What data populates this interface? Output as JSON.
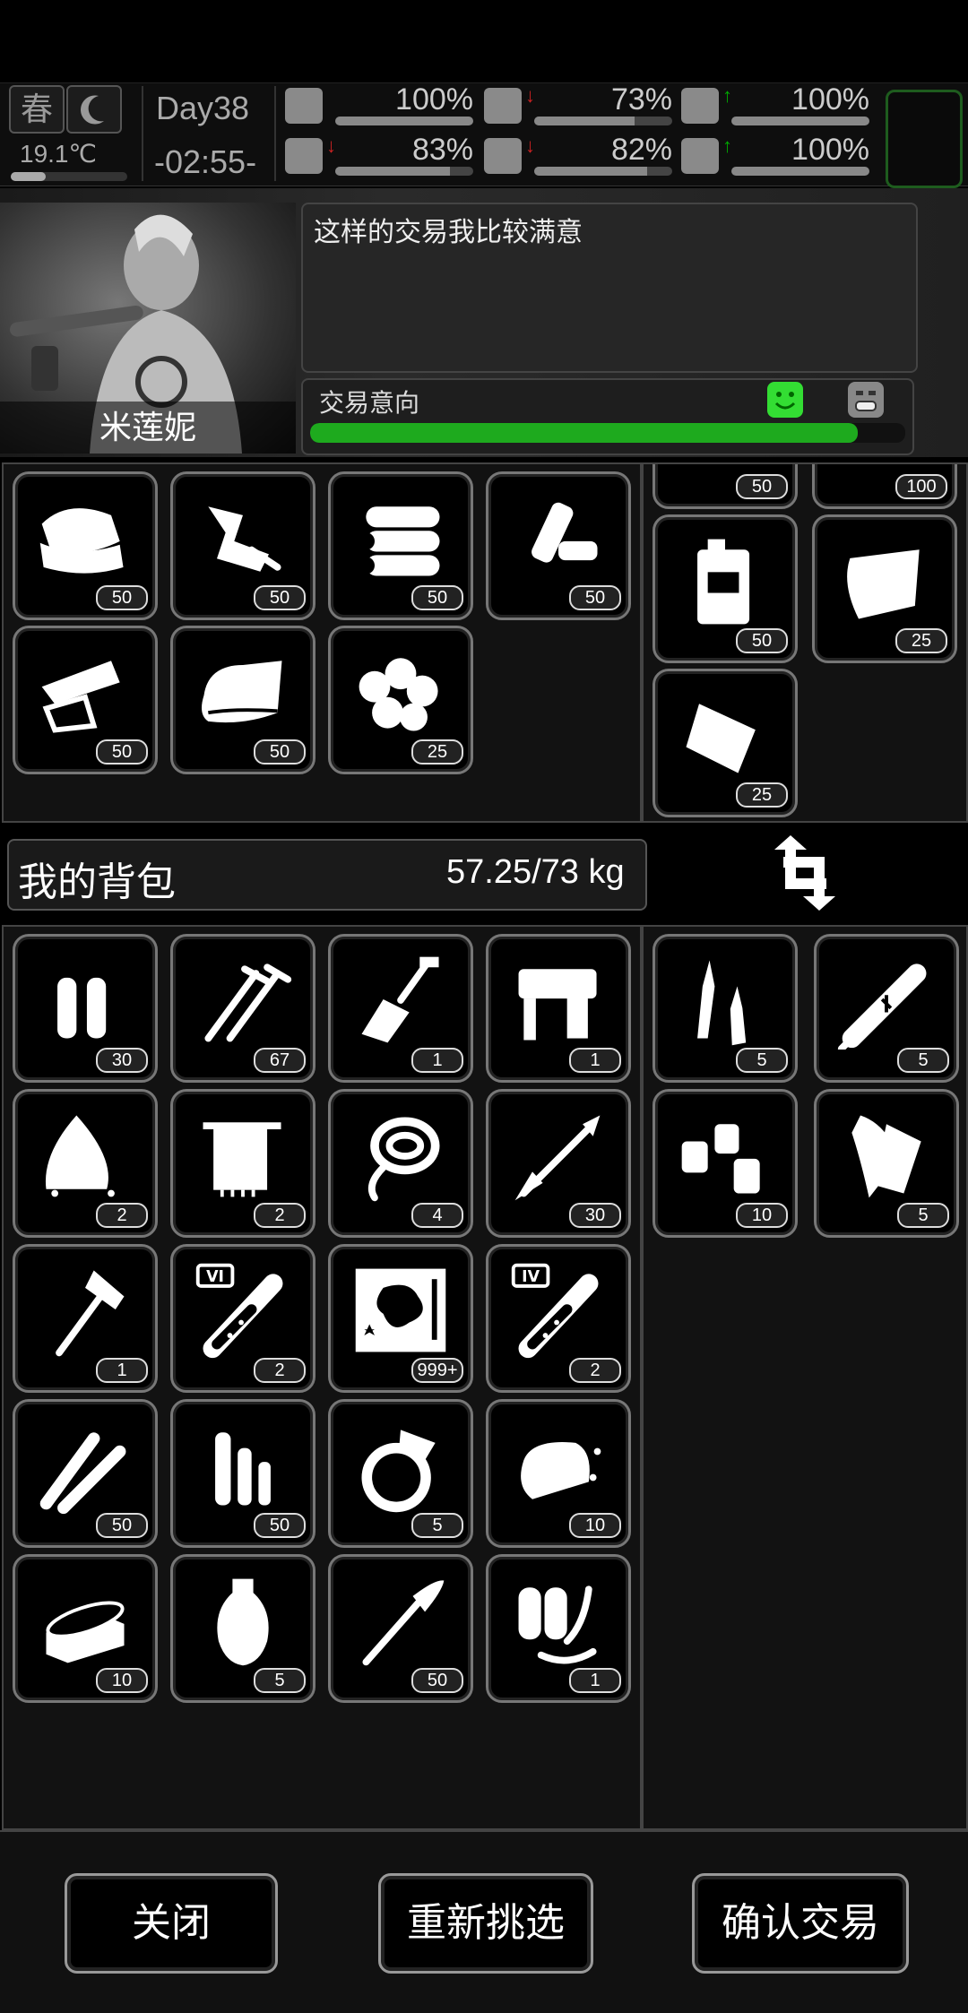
{
  "status": {
    "season": "春",
    "temperature": "19.1℃",
    "temperature_level": 0.3,
    "day": "Day38",
    "clock": "-02:55-",
    "stats": [
      {
        "name": "health",
        "value": "100%",
        "level": 1.0,
        "trend": ""
      },
      {
        "name": "hunger",
        "value": "73%",
        "level": 0.73,
        "trend": "down"
      },
      {
        "name": "mood",
        "value": "100%",
        "level": 1.0,
        "trend": "up"
      },
      {
        "name": "stamina",
        "value": "83%",
        "level": 0.83,
        "trend": "down"
      },
      {
        "name": "thirst",
        "value": "82%",
        "level": 0.82,
        "trend": "down"
      },
      {
        "name": "heart",
        "value": "100%",
        "level": 1.0,
        "trend": "up"
      }
    ]
  },
  "npc": {
    "name": "米莲妮",
    "dialog": "这样的交易我比较满意",
    "intent_label": "交易意向",
    "intent_level": 0.92
  },
  "trader_items": {
    "left": [
      {
        "icon": "cloth-icon",
        "count": "50"
      },
      {
        "icon": "scrap-parts-icon",
        "count": "50"
      },
      {
        "icon": "logs-icon",
        "count": "50"
      },
      {
        "icon": "plastic-bottles-icon",
        "count": "50"
      },
      {
        "icon": "paper-icon",
        "count": "50"
      },
      {
        "icon": "fabric-roll-icon",
        "count": "50"
      },
      {
        "icon": "cotton-icon",
        "count": "25"
      }
    ],
    "right": [
      {
        "icon": "item-icon",
        "count": "50"
      },
      {
        "icon": "item-icon",
        "count": "100"
      },
      {
        "icon": "jerrycan-icon",
        "count": "50"
      },
      {
        "icon": "tarp-icon",
        "count": "25"
      },
      {
        "icon": "bag-icon",
        "count": "25"
      }
    ]
  },
  "bag": {
    "title": "我的背包",
    "weight": "57.25/73 kg",
    "left": [
      {
        "icon": "bullets-icon",
        "count": "30"
      },
      {
        "icon": "nails-icon",
        "count": "67"
      },
      {
        "icon": "shovel-icon",
        "count": "1"
      },
      {
        "icon": "nail-gun-icon",
        "count": "1"
      },
      {
        "icon": "flint-icon",
        "count": "2"
      },
      {
        "icon": "towel-icon",
        "count": "2"
      },
      {
        "icon": "rope-icon",
        "count": "4"
      },
      {
        "icon": "arrow-icon",
        "count": "30"
      },
      {
        "icon": "axe-icon",
        "count": "1"
      },
      {
        "icon": "test-tube-vi-icon",
        "count": "2",
        "tag": "VI"
      },
      {
        "icon": "map-icon",
        "count": "999+"
      },
      {
        "icon": "test-tube-iv-icon",
        "count": "2",
        "tag": "IV"
      },
      {
        "icon": "rifle-ammo-icon",
        "count": "50"
      },
      {
        "icon": "shells-icon",
        "count": "50"
      },
      {
        "icon": "ring-icon",
        "count": "5"
      },
      {
        "icon": "bread-icon",
        "count": "10"
      },
      {
        "icon": "canned-food-icon",
        "count": "10"
      },
      {
        "icon": "vase-icon",
        "count": "5"
      },
      {
        "icon": "rocket-icon",
        "count": "50"
      },
      {
        "icon": "flamethrower-icon",
        "count": "1"
      }
    ],
    "right": [
      {
        "icon": "ampoules-icon",
        "count": "5"
      },
      {
        "icon": "syringe-icon",
        "count": "5"
      },
      {
        "icon": "pill-bottles-icon",
        "count": "10"
      },
      {
        "icon": "bandage-icon",
        "count": "5"
      }
    ]
  },
  "buttons": {
    "close": "关闭",
    "reselect": "重新挑选",
    "confirm": "确认交易"
  }
}
